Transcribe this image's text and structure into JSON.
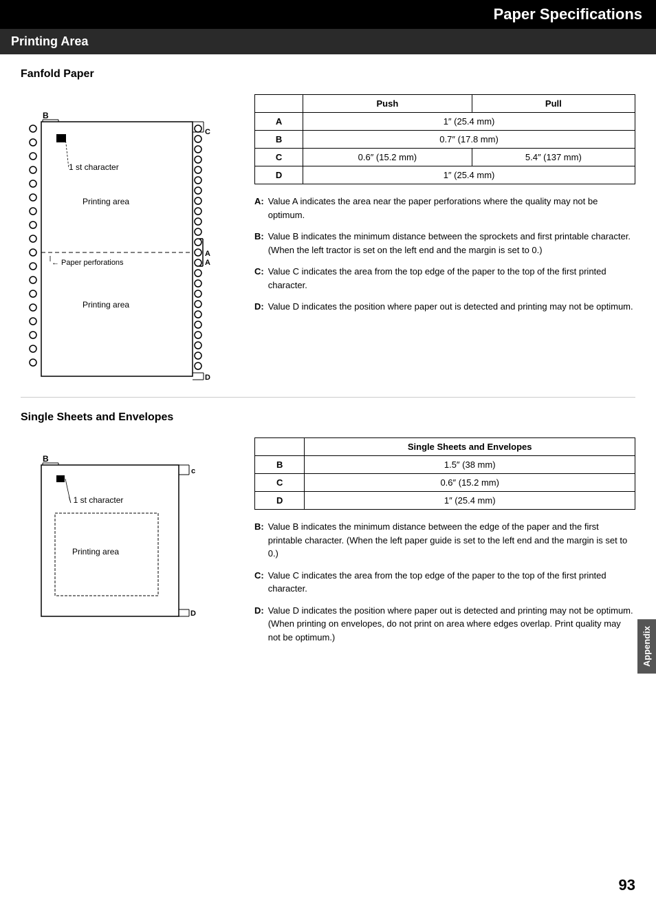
{
  "header": {
    "title": "Paper Specifications"
  },
  "printing_area": {
    "section_title": "Printing Area",
    "fanfold": {
      "subtitle": "Fanfold Paper",
      "table": {
        "col1": "",
        "col2": "Push",
        "col3": "Pull",
        "rows": [
          {
            "label": "A",
            "push": "1″ (25.4 mm)",
            "pull": "1″ (25.4 mm)",
            "merged": true
          },
          {
            "label": "B",
            "push": "0.7″ (17.8 mm)",
            "pull": "0.7″ (17.8 mm)",
            "merged": true
          },
          {
            "label": "C",
            "push": "0.6″ (15.2 mm)",
            "pull": "5.4″ (137 mm)",
            "merged": false
          },
          {
            "label": "D",
            "push": "1″ (25.4 mm)",
            "pull": "1″ (25.4 mm)",
            "merged": true
          }
        ]
      },
      "descriptions": [
        {
          "label": "A:",
          "text": "Value A indicates the area near the paper perforations where the quality may not be optimum."
        },
        {
          "label": "B:",
          "text": "Value B indicates the minimum distance between the sprockets and first printable character. (When the left tractor is set on the left end and the margin is set to 0.)"
        },
        {
          "label": "C:",
          "text": "Value C indicates the area from the top edge of the paper to the top of the first printed character."
        },
        {
          "label": "D:",
          "text": "Value D indicates the position where paper out is detected and printing may not be optimum."
        }
      ]
    },
    "single_sheets": {
      "subtitle": "Single Sheets and Envelopes",
      "table": {
        "col_header": "Single Sheets and Envelopes",
        "rows": [
          {
            "label": "B",
            "value": "1.5″ (38 mm)"
          },
          {
            "label": "C",
            "value": "0.6″ (15.2 mm)"
          },
          {
            "label": "D",
            "value": "1″ (25.4 mm)"
          }
        ]
      },
      "descriptions": [
        {
          "label": "B:",
          "text": "Value B indicates the minimum distance between the edge of the paper and the first printable character. (When the left paper guide is set to the left end and the margin is set to 0.)"
        },
        {
          "label": "C:",
          "text": "Value C indicates the area from the top edge of the paper to the top of the first printed character."
        },
        {
          "label": "D:",
          "text": "Value D indicates the position where paper out is detected and printing may not be optimum. (When printing on envelopes, do not print on area where edges overlap. Print quality may not be optimum.)"
        }
      ]
    }
  },
  "appendix_label": "Appendix",
  "page_number": "93"
}
